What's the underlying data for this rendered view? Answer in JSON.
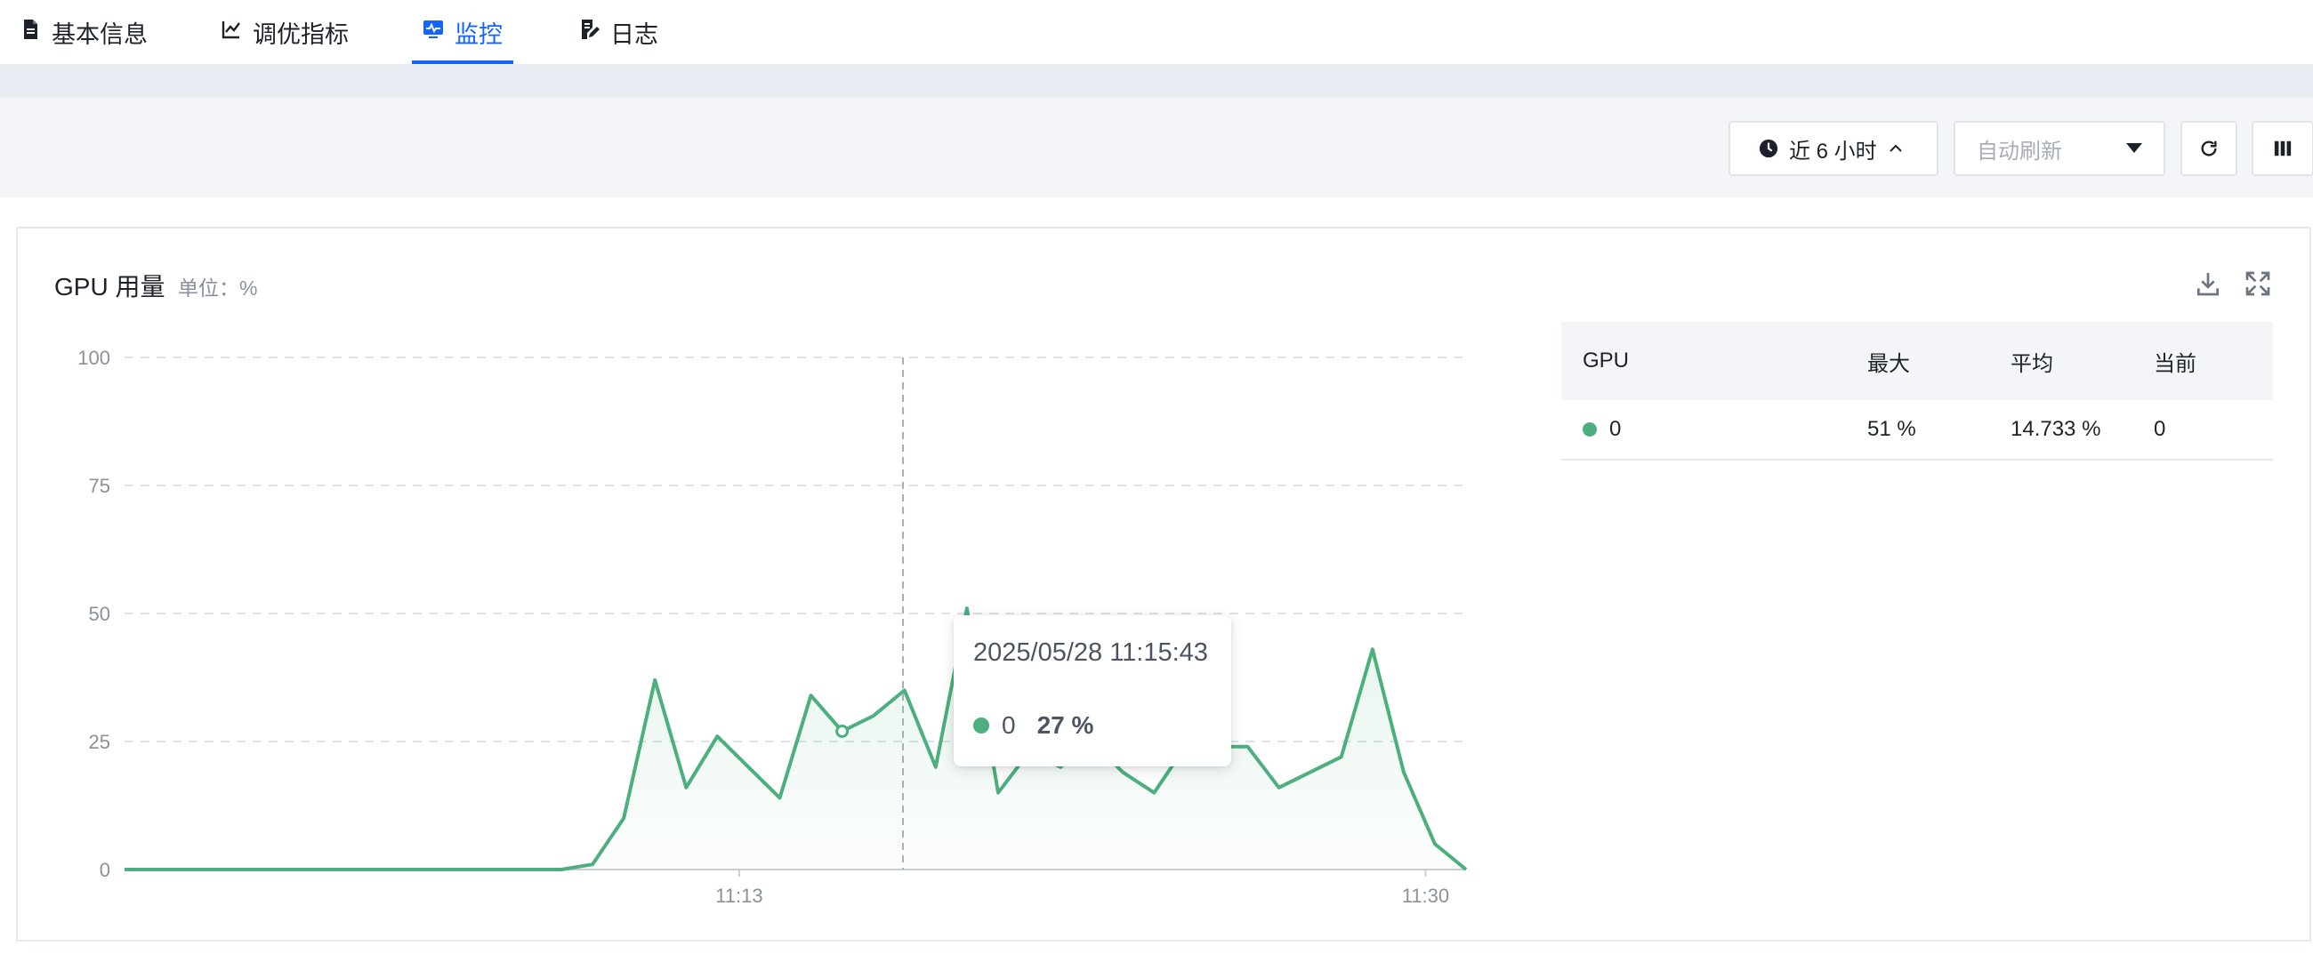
{
  "tabs": [
    {
      "label": "基本信息",
      "icon": "document-icon",
      "active": false
    },
    {
      "label": "调优指标",
      "icon": "line-chart-icon",
      "active": false
    },
    {
      "label": "监控",
      "icon": "monitor-icon",
      "active": true
    },
    {
      "label": "日志",
      "icon": "edit-log-icon",
      "active": false
    }
  ],
  "toolbar": {
    "time_range": "近 6 小时",
    "auto_refresh_placeholder": "自动刷新"
  },
  "panel": {
    "title": "GPU 用量",
    "unit": "单位：%"
  },
  "legend_table": {
    "headers": [
      "GPU",
      "最大",
      "平均",
      "当前"
    ],
    "rows": [
      {
        "name": "0",
        "max": "51 %",
        "avg": "14.733 %",
        "current": "0",
        "color": "#4caf7d"
      }
    ]
  },
  "tooltip": {
    "time": "2025/05/28 11:15:43",
    "series": "0",
    "value": "27 %"
  },
  "colors": {
    "accent": "#1664ff",
    "series": "#4caf7d",
    "grid": "#dfe2e7"
  },
  "chart_data": {
    "type": "area",
    "title": "GPU 用量",
    "unit": "%",
    "xlabel": "",
    "ylabel": "",
    "ylim": [
      0,
      100
    ],
    "yticks": [
      0,
      25,
      50,
      75,
      100
    ],
    "xtick_labels": [
      "11:13",
      "11:30"
    ],
    "grid": true,
    "series": [
      {
        "name": "0",
        "values": [
          0,
          0,
          0,
          0,
          0,
          0,
          0,
          0,
          0,
          0,
          0,
          0,
          0,
          0,
          0,
          1,
          10,
          37,
          16,
          26,
          20,
          14,
          34,
          27,
          30,
          35,
          20,
          51,
          15,
          23,
          20,
          25,
          19,
          15,
          24,
          24,
          24,
          16,
          19,
          22,
          43,
          19,
          5,
          0
        ]
      }
    ],
    "hover_index": 23
  }
}
